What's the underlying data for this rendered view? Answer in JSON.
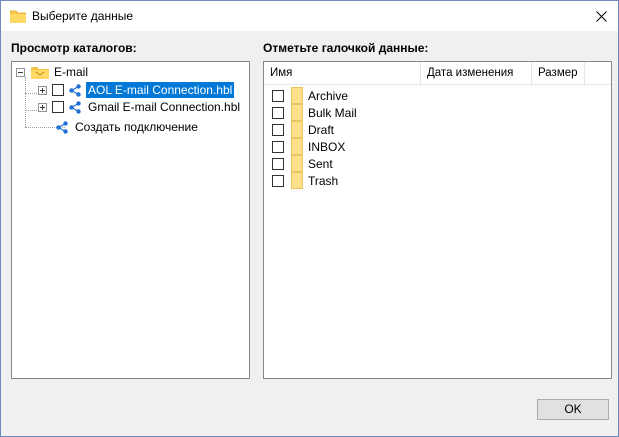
{
  "window": {
    "title": "Выберите данные",
    "close_icon": "close-icon",
    "folder_icon": "folder-icon"
  },
  "left": {
    "label": "Просмотр каталогов:",
    "tree": {
      "root": "E-mail",
      "children": [
        {
          "label": "AOL E-mail Connection.hbl",
          "selected": true
        },
        {
          "label": "Gmail E-mail Connection.hbl",
          "selected": false
        }
      ],
      "create": "Создать подключение"
    }
  },
  "right": {
    "label": "Отметьте галочкой данные:",
    "columns": [
      "Имя",
      "Дата изменения",
      "Размер"
    ],
    "items": [
      "Archive",
      "Bulk Mail",
      "Draft",
      "INBOX",
      "Sent",
      "Trash"
    ]
  },
  "buttons": {
    "ok": "OK"
  },
  "colors": {
    "accent": "#0078d7",
    "folder": "#ffe08a",
    "share_icon": "#1e6fd6"
  }
}
